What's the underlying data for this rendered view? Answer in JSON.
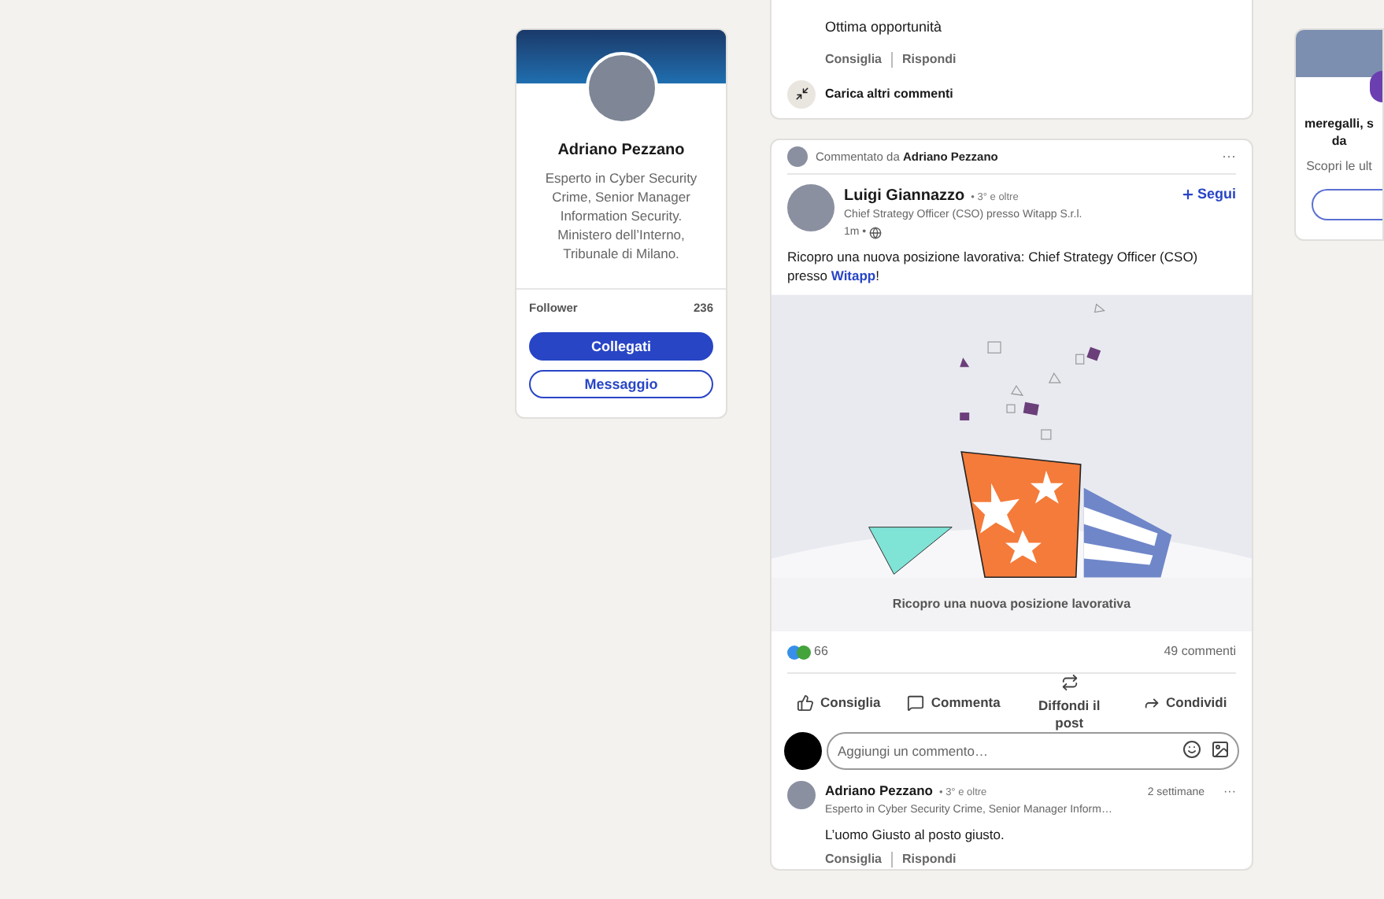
{
  "profile_card": {
    "name": "Adriano Pezzano",
    "headline": "Esperto in Cyber Security Crime, Senior Manager Information Security. Ministero dell’Interno, Tribunale di Milano.",
    "stats": [
      {
        "label": "Follower",
        "value": "236"
      }
    ],
    "buttons": [
      {
        "label": "Collegati",
        "kind": "primary"
      },
      {
        "label": "Messaggio",
        "kind": "secondary"
      }
    ]
  },
  "previous_comment": {
    "text": "Ottima opportunità",
    "actions": [
      "Consiglia",
      "Rispondi"
    ],
    "load_more": "Carica altri commenti"
  },
  "post": {
    "context_prefix": "Commentato da",
    "context_name": "Adriano Pezzano",
    "more": "···",
    "author": {
      "name": "Luigi Giannazzo",
      "degree": "• 3° e oltre",
      "headline": "Chief Strategy Officer (CSO) presso Witapp S.r.l.",
      "time": "1m •"
    },
    "follow": "Segui",
    "body_text": "Ricopro una nuova posizione lavorativa: Chief Strategy Officer (CSO) presso ",
    "body_link": "Witapp",
    "body_suffix": "!",
    "image_caption": "Ricopro una nuova posizione lavorativa",
    "reactions_count": "66",
    "comments_count": "49 commenti",
    "actions": [
      {
        "label": "Consiglia",
        "kind": "like"
      },
      {
        "label": "Commenta",
        "kind": "comment"
      },
      {
        "label": "Diffondi il post",
        "kind": "repost"
      },
      {
        "label": "Condividi",
        "kind": "share"
      }
    ],
    "comment_field": {
      "placeholder": "Aggiungi un commento…"
    },
    "comment": {
      "name": "Adriano Pezzano",
      "degree": "• 3° e oltre",
      "headline": "Esperto in Cyber Security Crime, Senior Manager Inform…",
      "time": "2 settimane",
      "more": "···",
      "text": "L’uomo Giusto al posto giusto.",
      "actions": [
        "Consiglia",
        "Rispondi"
      ]
    }
  },
  "right_card": {
    "title_lines": [
      "meregalli, s",
      "da"
    ],
    "text": "Scopri le ult"
  }
}
